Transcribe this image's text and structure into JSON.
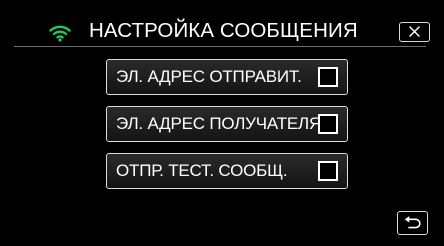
{
  "header": {
    "title": "НАСТРОЙКА СООБЩЕНИЯ",
    "wifi_icon": "wifi-icon",
    "close_icon": "close-icon",
    "accent_color": "#22c55e"
  },
  "menu": {
    "items": [
      {
        "label": "ЭЛ. АДРЕС ОТПРАВИТ.",
        "checked": false
      },
      {
        "label": "ЭЛ. АДРЕС ПОЛУЧАТЕЛЯ",
        "checked": false
      },
      {
        "label": "ОТПР. ТЕСТ. СООБЩ.",
        "checked": false
      }
    ]
  },
  "footer": {
    "back_icon": "return-arrow-icon"
  }
}
